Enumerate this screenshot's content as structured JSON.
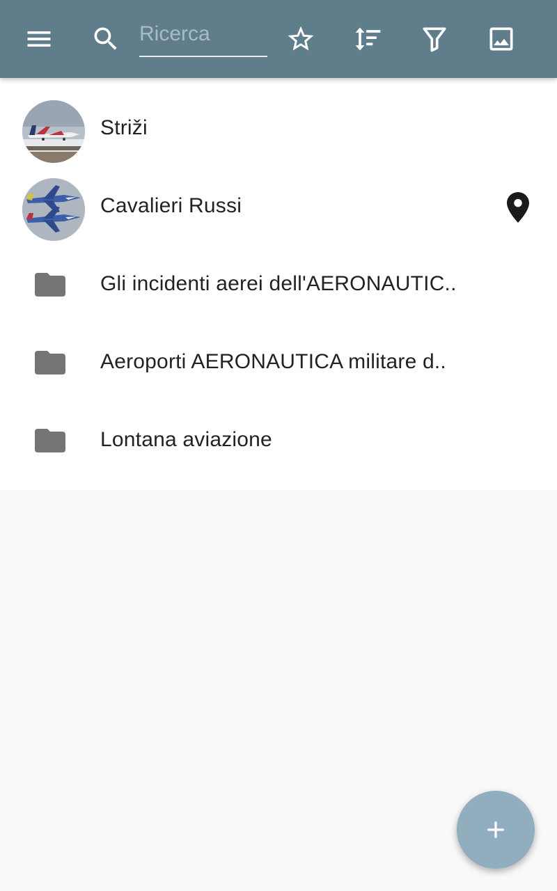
{
  "colors": {
    "appbar": "#607d8b",
    "fab": "#90aebd",
    "folder": "#757575",
    "text": "#222222"
  },
  "toolbar": {
    "menu_icon": "menu-icon",
    "search_icon": "search-icon",
    "search_placeholder": "Ricerca",
    "search_value": "",
    "star_icon": "star-outline-icon",
    "sort_icon": "sort-icon",
    "filter_icon": "filter-icon",
    "image_icon": "image-icon"
  },
  "list": {
    "items": [
      {
        "label": "Striži",
        "kind": "photo",
        "icon": "aircraft-thumbnail"
      },
      {
        "label": "Cavalieri Russi",
        "kind": "photo",
        "icon": "aircraft-thumbnail",
        "trailing_icon": "map-pin-icon"
      },
      {
        "label": "Gli incidenti aerei dell'AERONAUTIC..",
        "kind": "folder",
        "icon": "folder-icon"
      },
      {
        "label": "Aeroporti AERONAUTICA militare d..",
        "kind": "folder",
        "icon": "folder-icon"
      },
      {
        "label": "Lontana aviazione",
        "kind": "folder",
        "icon": "folder-icon"
      }
    ]
  },
  "fab": {
    "icon": "plus-icon"
  }
}
